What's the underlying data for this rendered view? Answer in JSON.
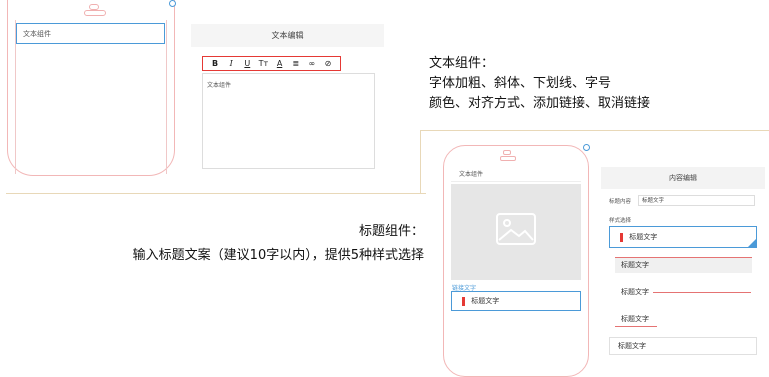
{
  "text_component": {
    "phone_label": "文本组件",
    "editor_title": "文本编辑",
    "toolbar": [
      "B",
      "I",
      "U",
      "Tт",
      "A",
      "≣",
      "∞",
      "⊘"
    ],
    "textarea_text": "文本组件"
  },
  "desc_text": {
    "title": "文本组件：",
    "line1": "字体加粗、斜体、下划线、字号",
    "line2": "颜色、对齐方式、添加链接、取消链接"
  },
  "desc_heading": {
    "title": "标题组件：",
    "line1": "输入标题文案（建议10字以内），提供5种样式选择"
  },
  "heading_component": {
    "phone_title": "文本组件",
    "link_text": "链接文字",
    "heading_text": "标题文字",
    "panel_title": "内容编辑",
    "content_label": "标题内容",
    "content_value": "标题文字",
    "style_label": "样式选择",
    "styles": [
      "标题文字",
      "标题文字",
      "标题文字",
      "标题文字",
      "标题文字"
    ]
  },
  "colors": {
    "accent": "#4b9ad8",
    "red": "#e53935"
  }
}
